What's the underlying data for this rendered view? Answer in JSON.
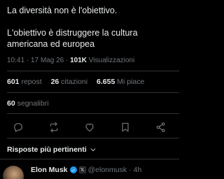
{
  "tweet": {
    "line1": "La diversità non è l'obiettivo.",
    "line2": "L'obiettivo è distruggere la cultura americana ed europea"
  },
  "meta": {
    "time": "10:41",
    "sep1": "·",
    "date": "17 Mag 26",
    "sep2": "·",
    "views_count": "101K",
    "views_label": "Visualizzazioni"
  },
  "stats": {
    "reposts_count": "601",
    "reposts_label": "repost",
    "quotes_count": "26",
    "quotes_label": "citazioni",
    "likes_count": "6.655",
    "likes_label": "Mi piace",
    "bookmarks_count": "60",
    "bookmarks_label": "segnalibri"
  },
  "actions": {
    "icons": [
      "reply-icon",
      "repost-icon",
      "like-icon",
      "bookmark-icon",
      "share-icon"
    ]
  },
  "replies": {
    "filter_label": "Risposte più pertinenti"
  },
  "reply": {
    "name": "Elon Musk",
    "handle": "@elonmusk",
    "sep": "·",
    "time": "4h",
    "x_badge": "𝕏"
  },
  "colors": {
    "background": "#000000",
    "text": "#e7e9ea",
    "muted": "#71767b",
    "divider": "#2f3336",
    "verified": "#1d9bf0"
  }
}
